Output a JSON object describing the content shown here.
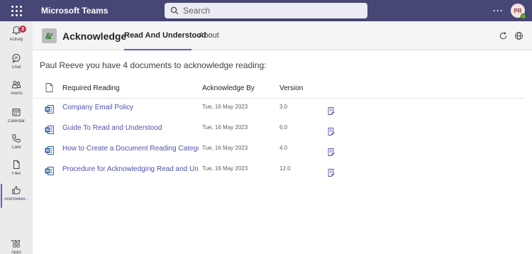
{
  "topbar": {
    "app_title": "Microsoft Teams",
    "search_placeholder": "Search",
    "more_label": "···",
    "avatar_initials": "PR",
    "bar_color": "#464775"
  },
  "rail": {
    "items": [
      {
        "label": "Activity",
        "icon": "bell-icon",
        "badge": "3"
      },
      {
        "label": "Chat",
        "icon": "chat-icon"
      },
      {
        "label": "Teams",
        "icon": "teams-icon"
      },
      {
        "label": "Calendar",
        "icon": "calendar-icon"
      },
      {
        "label": "Calls",
        "icon": "phone-icon"
      },
      {
        "label": "Files",
        "icon": "file-icon"
      },
      {
        "label": "Acknowled...",
        "icon": "thumbs-up-icon",
        "active": true
      }
    ],
    "more_label": "···",
    "apps_label": "Apps"
  },
  "app_header": {
    "name": "Acknowledge",
    "tabs": [
      {
        "label": "Read And Understood",
        "active": true
      },
      {
        "label": "About",
        "active": false
      }
    ],
    "accent": "#5b5fc7"
  },
  "content": {
    "intro": "Paul Reeve you have 4 documents to acknowledge reading:",
    "columns": {
      "title": "Required Reading",
      "ack_by": "Acknowledge By",
      "version": "Version"
    },
    "documents": [
      {
        "title": "Company Email Policy",
        "ack_by": "Tue, 16 May 2023",
        "version": "3.0"
      },
      {
        "title": "Guide To Read and Understood",
        "ack_by": "Tue, 16 May 2023",
        "version": "6.0"
      },
      {
        "title": "How to Create a Document Reading Category",
        "ack_by": "Tue, 16 May 2023",
        "version": "4.0"
      },
      {
        "title": "Procedure for Acknowledging Read and Understood",
        "ack_by": "Tue, 16 May 2023",
        "version": "12.0"
      }
    ],
    "link_color": "#4f52b2",
    "word_color": "#2b579a"
  }
}
